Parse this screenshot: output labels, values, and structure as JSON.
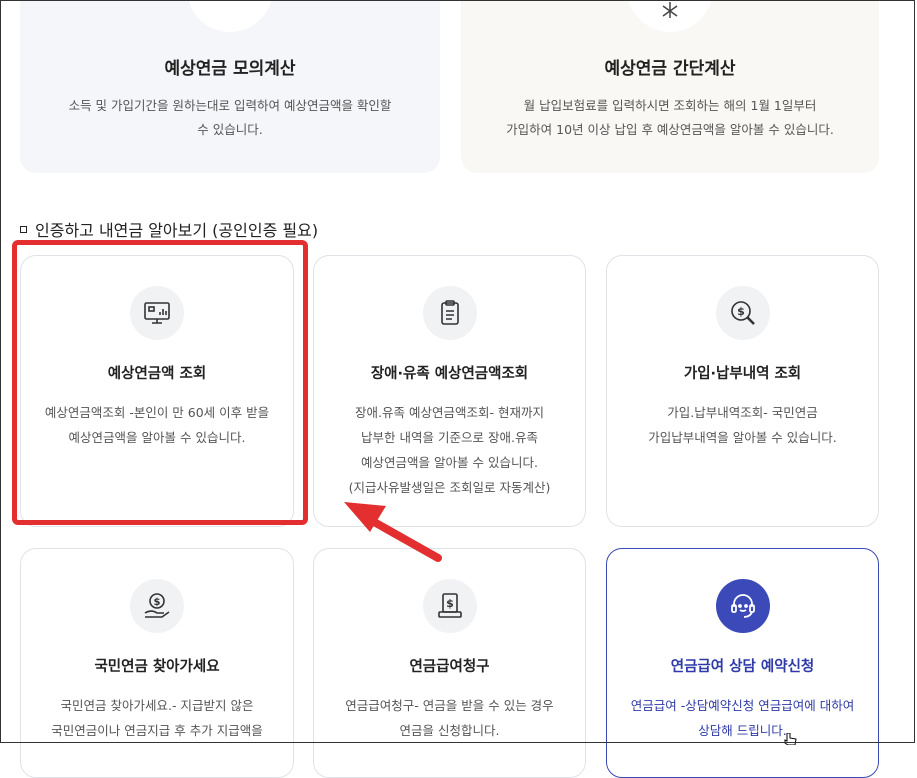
{
  "top_cards": [
    {
      "title": "예상연금 모의계산",
      "desc1": "소득 및 가입기간을 원하는대로 입력하여 예상연금액을 확인할",
      "desc2": "수 있습니다."
    },
    {
      "title": "예상연금 간단계산",
      "desc1": "월 납입보험료를 입력하시면 조회하는 해의 1월 1일부터",
      "desc2": "가입하여 10년 이상 납입 후 예상연금액을 알아볼 수 있습니다."
    }
  ],
  "section": {
    "title": "인증하고 내연금 알아보기 (공인인증 필요)"
  },
  "cards": [
    {
      "title": "예상연금액 조회",
      "icon": "monitor-chart-icon",
      "lines": [
        "예상연금액조회 -본인이 만 60세 이후 받을",
        "예상연금액을 알아볼 수 있습니다."
      ]
    },
    {
      "title": "장애·유족 예상연금액조회",
      "icon": "clipboard-icon",
      "lines": [
        "장애.유족 예상연금액조회- 현재까지",
        "납부한 내역을 기준으로 장애.유족",
        "예상연금액을 알아볼 수 있습니다.",
        "(지급사유발생일은 조회일로 자동계산)"
      ]
    },
    {
      "title": "가입·납부내역 조회",
      "icon": "magnifier-dollar-icon",
      "lines": [
        "가입.납부내역조회- 국민연금",
        "가입납부내역을 알아볼 수 있습니다."
      ]
    },
    {
      "title": "국민연금 찾아가세요",
      "icon": "hand-coin-icon",
      "lines": [
        "국민연금 찾아가세요.- 지급받지 않은",
        "국민연금이나 연금지급 후 추가 지급액을"
      ]
    },
    {
      "title": "연금급여청구",
      "icon": "document-dollar-icon",
      "lines": [
        "연금급여청구- 연금을 받을 수 있는 경우",
        "연금을 신청합니다."
      ]
    },
    {
      "title": "연금급여 상담 예약신청",
      "icon": "headset-icon",
      "lines": [
        "연금급여 -상담예약신청 연금급여에 대하여",
        "상담해 드립니다."
      ]
    }
  ],
  "colors": {
    "highlight": "#e32f2f",
    "accent": "#3a4ab4"
  }
}
